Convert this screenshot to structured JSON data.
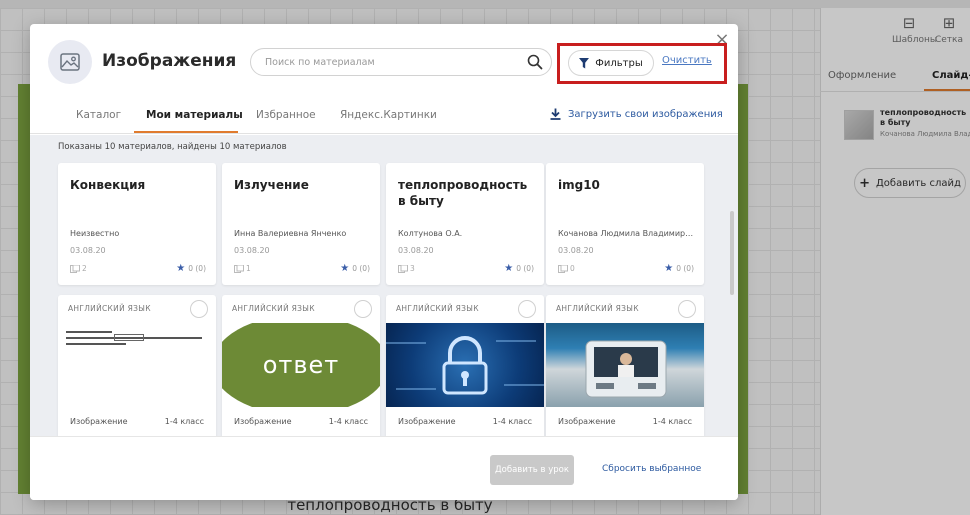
{
  "background": {
    "toolbar": [
      {
        "label": "Шаблоны",
        "icon": "templates-icon"
      },
      {
        "label": "Сетка",
        "icon": "grid-icon"
      }
    ],
    "right_tabs": [
      "Оформление",
      "Слайд-ш"
    ],
    "slide_thumb": {
      "title": "теплопроводность в быту",
      "author": "Кочанова Людмила Влад"
    },
    "add_slide_label": "Добавить слайд",
    "slide_title": "теплопроводность в быту"
  },
  "modal": {
    "title": "Изображения",
    "search_placeholder": "Поиск по материалам",
    "filter_label": "Фильтры",
    "clear_label": "Очистить",
    "close_label": "×",
    "tabs": [
      {
        "label": "Каталог",
        "active": false
      },
      {
        "label": "Мои материалы",
        "active": true
      },
      {
        "label": "Избранное",
        "active": false
      },
      {
        "label": "Яндекс.Картинки",
        "active": false
      }
    ],
    "upload_label": "Загрузить свои изображения",
    "results_count": "Показаны 10 материалов, найдены 10 материалов",
    "top_cards": [
      {
        "title": "Конвекция",
        "author": "Неизвестно",
        "date": "03.08.20",
        "pages": "2",
        "rating": "0 (0)"
      },
      {
        "title": "Излучение",
        "author": "Инна Валериевна Янченко",
        "date": "03.08.20",
        "pages": "1",
        "rating": "0 (0)"
      },
      {
        "title": "теплопроводность в быту",
        "author": "Колтунова О.А.",
        "date": "03.08.20",
        "pages": "3",
        "rating": "0 (0)"
      },
      {
        "title": "img10",
        "author": "Кочанова Людмила Владимиров...",
        "date": "03.08.20",
        "pages": "0",
        "rating": "0 (0)"
      }
    ],
    "bottom_cards": [
      {
        "subject": "АНГЛИЙСКИЙ ЯЗЫК",
        "type": "Изображение",
        "grade": "1-4 класс",
        "preview": "text"
      },
      {
        "subject": "АНГЛИЙСКИЙ ЯЗЫК",
        "type": "Изображение",
        "grade": "1-4 класс",
        "preview": "green",
        "preview_word": "ответ"
      },
      {
        "subject": "АНГЛИЙСКИЙ ЯЗЫК",
        "type": "Изображение",
        "grade": "1-4 класс",
        "preview": "lock"
      },
      {
        "subject": "АНГЛИЙСКИЙ ЯЗЫК",
        "type": "Изображение",
        "grade": "1-4 класс",
        "preview": "bus"
      }
    ],
    "add_button_label": "Добавить в урок",
    "reset_label": "Сбросить выбранное"
  },
  "colors": {
    "accent_orange": "#e07b2e",
    "link_blue": "#2d5aa0",
    "highlight_red": "#c81e1e",
    "slide_green": "#7ea640"
  }
}
